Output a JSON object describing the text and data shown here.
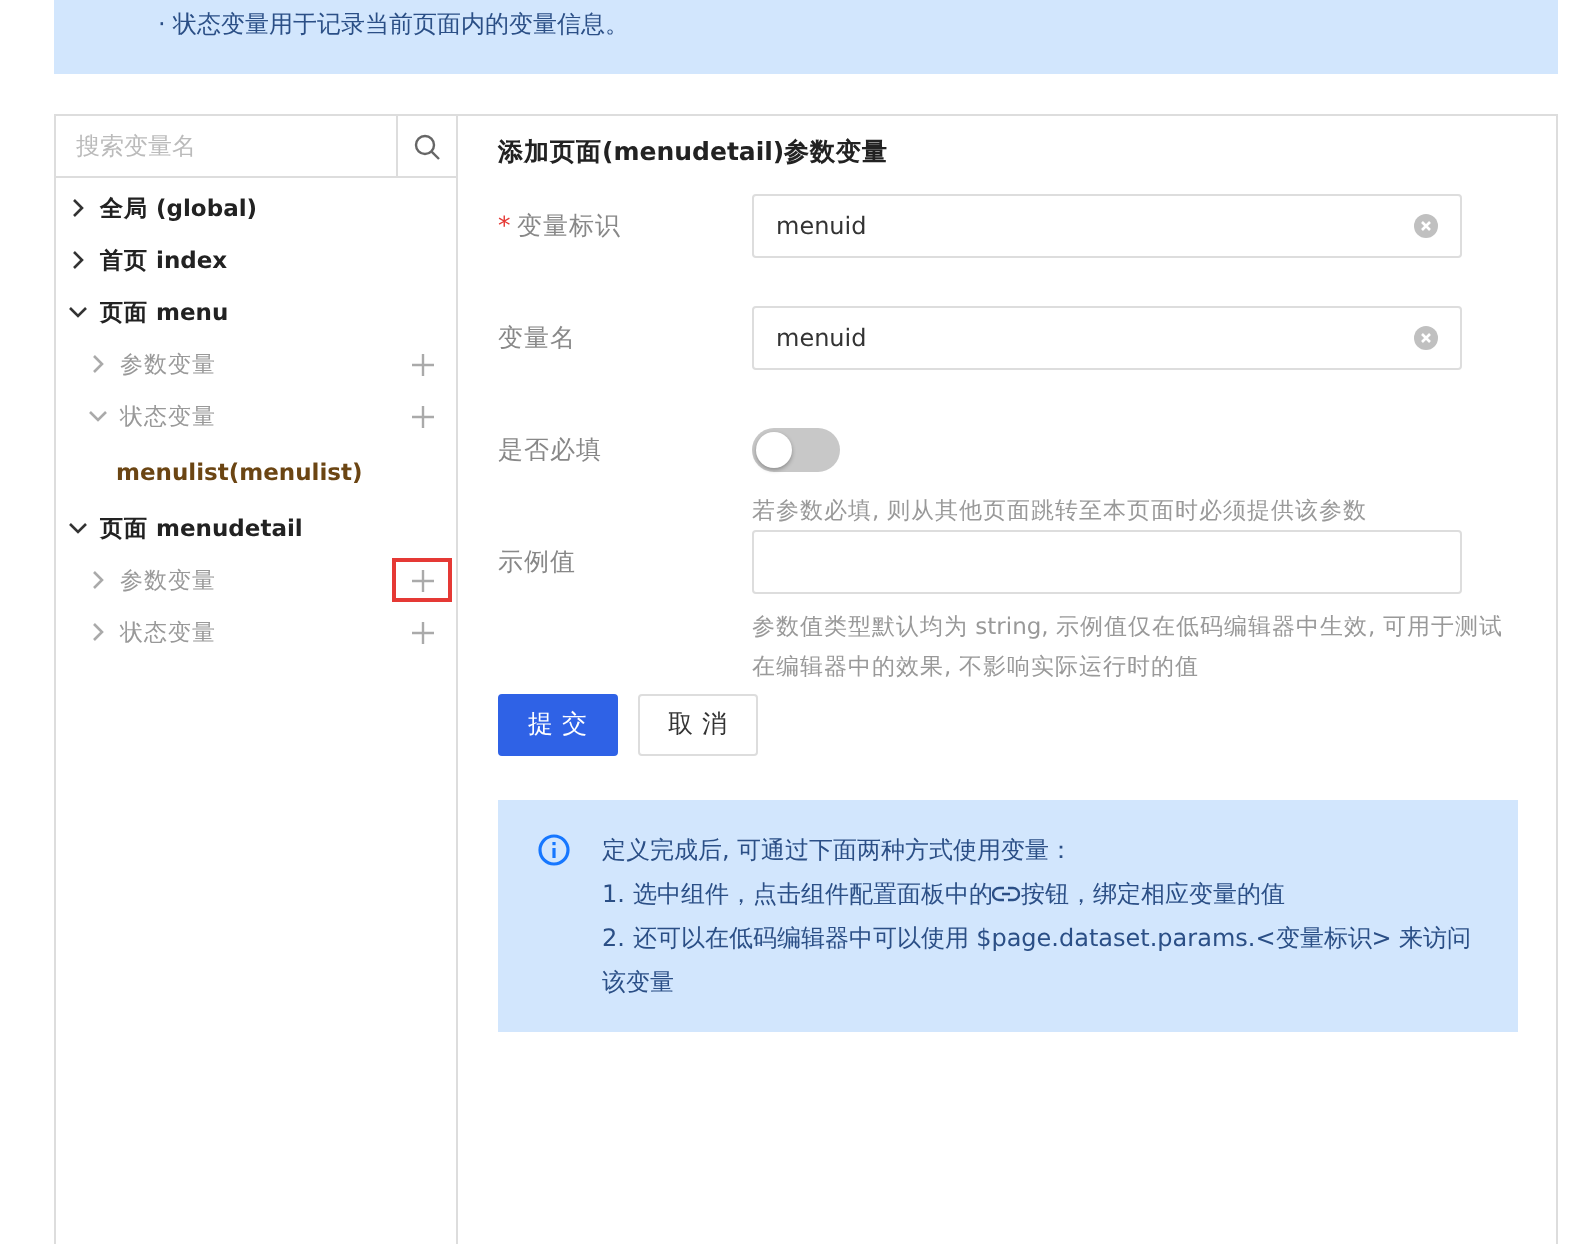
{
  "banner": {
    "lines": [
      "· 状态变量用于记录当前页面内的变量信息。"
    ]
  },
  "sidebar": {
    "search": {
      "placeholder": "搜索变量名"
    },
    "tree": [
      {
        "kind": "page",
        "label": "全局 (global)",
        "expanded": false
      },
      {
        "kind": "page",
        "label": "首页 index",
        "expanded": false
      },
      {
        "kind": "page",
        "label": "页面 menu",
        "expanded": true,
        "children": [
          {
            "kind": "group",
            "label": "参数变量",
            "expanded": false,
            "highlighted": false
          },
          {
            "kind": "group",
            "label": "状态变量",
            "expanded": true,
            "highlighted": false,
            "children": [
              {
                "kind": "variable",
                "label": "menulist(menulist)"
              }
            ]
          }
        ]
      },
      {
        "kind": "page",
        "label": "页面 menudetail",
        "expanded": true,
        "children": [
          {
            "kind": "group",
            "label": "参数变量",
            "expanded": false,
            "highlighted": true
          },
          {
            "kind": "group",
            "label": "状态变量",
            "expanded": false,
            "highlighted": false
          }
        ]
      }
    ]
  },
  "form": {
    "title": "添加页面(menudetail)参数变量",
    "fields": [
      {
        "kind": "text",
        "label": "变量标识",
        "required_mark": "*",
        "value": "menuid"
      },
      {
        "kind": "text",
        "label": "变量名",
        "value": "menuid"
      },
      {
        "kind": "switch",
        "label": "是否必填",
        "on": false,
        "help": "若参数必填, 则从其他页面跳转至本页面时必须提供该参数"
      },
      {
        "kind": "text",
        "label": "示例值",
        "help": "参数值类型默认均为 string, 示例值仅在低码编辑器中生效, 可用于测试在编辑器中的效果, 不影响实际运行时的值"
      }
    ],
    "buttons": [
      {
        "label": "提 交",
        "primary": true
      },
      {
        "label": "取 消",
        "primary": false
      }
    ]
  },
  "info": {
    "heading": "定义完成后, 可通过下面两种方式使用变量：",
    "items": [
      {
        "before": "1. 选中组件，点击组件配置面板中的",
        "after": "按钮，绑定相应变量的值"
      },
      {
        "before": "2. 还可以在低码编辑器中可以使用 $page.dataset.params.<变量标识> 来访问该变量"
      }
    ]
  }
}
